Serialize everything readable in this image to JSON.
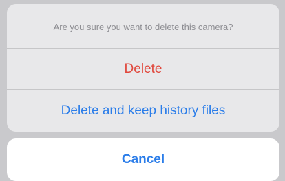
{
  "action_sheet": {
    "message": "Are you sure you want to delete this camera?",
    "actions": [
      {
        "label": "Delete",
        "style": "destructive",
        "color": "#e0473c"
      },
      {
        "label": "Delete and keep history files",
        "style": "default",
        "color": "#2b7de9"
      }
    ],
    "cancel_label": "Cancel",
    "cancel_color": "#2b7de9"
  }
}
